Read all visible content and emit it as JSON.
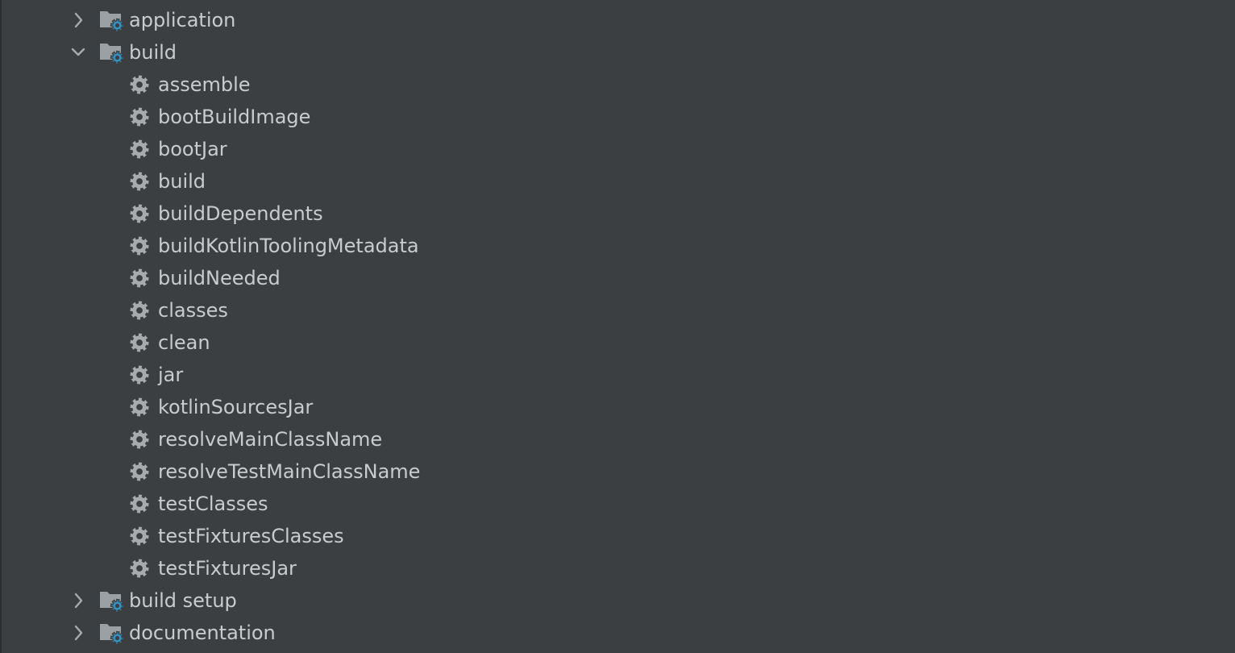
{
  "colors": {
    "background": "#3c3f41",
    "text": "#c9ccce",
    "icon_grey": "#a7abae",
    "folder_grey": "#9aa0a4",
    "gear_badge_blue": "#3592c4"
  },
  "tree": {
    "groups": [
      {
        "label": "application",
        "expanded": false,
        "icon": "task-group-folder-icon"
      },
      {
        "label": "build",
        "expanded": true,
        "icon": "task-group-folder-icon",
        "tasks": [
          "assemble",
          "bootBuildImage",
          "bootJar",
          "build",
          "buildDependents",
          "buildKotlinToolingMetadata",
          "buildNeeded",
          "classes",
          "clean",
          "jar",
          "kotlinSourcesJar",
          "resolveMainClassName",
          "resolveTestMainClassName",
          "testClasses",
          "testFixturesClasses",
          "testFixturesJar"
        ]
      },
      {
        "label": "build setup",
        "expanded": false,
        "icon": "task-group-folder-icon"
      },
      {
        "label": "documentation",
        "expanded": false,
        "icon": "task-group-folder-icon"
      }
    ]
  }
}
